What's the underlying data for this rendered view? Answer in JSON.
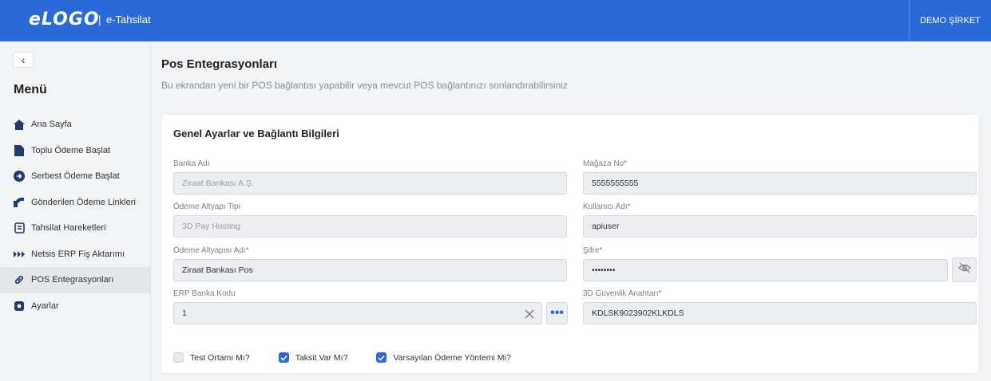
{
  "header": {
    "logo": "eLOGO",
    "separator": "|",
    "app_name": "e-Tahsilat",
    "company": "DEMO ŞİRKET"
  },
  "sidebar": {
    "collapse": "‹",
    "title": "Menü",
    "items": [
      {
        "label": "Ana Sayfa",
        "icon": "home-icon"
      },
      {
        "label": "Toplu Ödeme Başlat",
        "icon": "file-icon"
      },
      {
        "label": "Serbest Ödeme Başlat",
        "icon": "arrow-circle-icon"
      },
      {
        "label": "Gönderilen Ödeme Linkleri",
        "icon": "share-icon"
      },
      {
        "label": "Tahsilat Hareketleri",
        "icon": "document-icon"
      },
      {
        "label": "Netsis ERP Fiş Aktarımı",
        "icon": "transfer-icon"
      },
      {
        "label": "POS Entegrasyonları",
        "icon": "link-icon",
        "active": true
      },
      {
        "label": "Ayarlar",
        "icon": "gear-icon"
      }
    ]
  },
  "page": {
    "title": "Pos Entegrasyonları",
    "subtitle": "Bu ekrandan yeni bir POS bağlantısı yapabilir veya mevcut POS bağlantınızı sonlandırabilirsiniz"
  },
  "card": {
    "title": "Genel Ayarlar ve Bağlantı Bilgileri",
    "fields": {
      "banka_adi": {
        "label": "Banka Adı",
        "value": "Ziraat Bankası A.Ş."
      },
      "odeme_altyapi_tipi": {
        "label": "Ödeme Altyapı Tipi",
        "value": "3D Pay Hosting"
      },
      "odeme_altyapisi_adi": {
        "label": "Ödeme Altyapısı Adı*",
        "value": "Ziraat Bankası Pos"
      },
      "erp_banka_kodu": {
        "label": "ERP Banka Kodu",
        "value": "1",
        "lookup": "•••"
      },
      "magaza_no": {
        "label": "Mağaza No*",
        "value": "5555555555"
      },
      "kullanici_adi": {
        "label": "Kullanıcı Adı*",
        "value": "apiuser"
      },
      "sifre": {
        "label": "Şifre*",
        "value": "••••••••"
      },
      "guvenlik_anahtari": {
        "label": "3D Güvenlik Anahtarı*",
        "value": "KDLSK9023902KLKDLS"
      }
    },
    "checkboxes": [
      {
        "label": "Test Ortamı Mı?",
        "checked": false
      },
      {
        "label": "Taksit Var Mı?",
        "checked": true
      },
      {
        "label": "Varsayılan Ödeme Yöntemi Mi?",
        "checked": true
      }
    ]
  },
  "colors": {
    "brand": "#2a6ad8",
    "background": "#f2f3f5",
    "input_bg": "#eceef1"
  }
}
